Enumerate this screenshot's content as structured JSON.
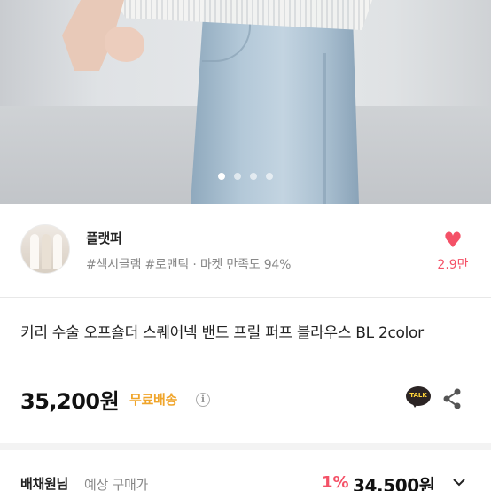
{
  "product_image": {
    "slide_count": 4,
    "active_slide_index": 0
  },
  "seller": {
    "name": "플랫퍼",
    "tags": "#섹시글램 #로맨틱 · 마켓 만족도 94%",
    "like_count": "2.9만",
    "like_color": "#f45167"
  },
  "product": {
    "title": "키리 수술 오프숄더 스퀘어넥 밴드 프릴 퍼프 블라우스 BL 2color",
    "price": "35,200원",
    "shipping": "무료배송",
    "shipping_color": "#f0a52b",
    "info_icon": "i",
    "talk_label": "TALK"
  },
  "buyer_price": {
    "user": "배채원님",
    "label": "예상 구매가",
    "discount": "1%",
    "final_price": "34,500원"
  }
}
